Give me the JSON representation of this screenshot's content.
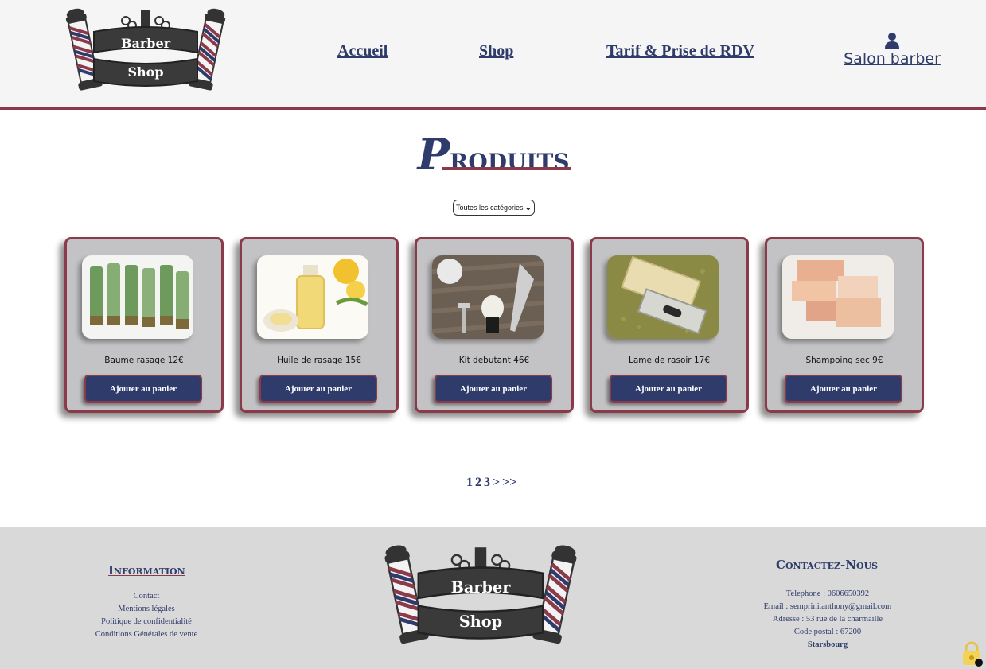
{
  "header": {
    "logo_text_top": "Barber",
    "logo_text_bottom": "Shop",
    "nav": [
      {
        "label": "Accueil"
      },
      {
        "label": "Shop"
      },
      {
        "label": "Tarif & Prise de RDV"
      }
    ],
    "account": {
      "label": "Salon barber",
      "icon": "user-icon"
    }
  },
  "main": {
    "title_cap": "P",
    "title_rest": "roduits",
    "category_filter": {
      "selected": "Toutes les catégories"
    },
    "products": [
      {
        "name": "Baume rasage 12€",
        "button": "Ajouter au panier",
        "image": "green-tubes"
      },
      {
        "name": "Huile de rasage 15€",
        "button": "Ajouter au panier",
        "image": "oil-bottle"
      },
      {
        "name": "Kit debutant 46€",
        "button": "Ajouter au panier",
        "image": "shaving-kit"
      },
      {
        "name": "Lame de rasoir 17€",
        "button": "Ajouter au panier",
        "image": "razor-blade"
      },
      {
        "name": "Shampoing sec 9€",
        "button": "Ajouter au panier",
        "image": "soap-bars"
      }
    ],
    "pagination": {
      "pages": [
        "1",
        "2",
        "3"
      ],
      "next": ">",
      "last": ">>"
    }
  },
  "footer": {
    "info_title": "Information",
    "info_links": [
      "Contact",
      "Mentions légales",
      "Politique de confidentialité",
      "Conditions Générales de vente"
    ],
    "contact_title": "Contactez-Nous",
    "contact_lines": [
      "Telephone : 0606650392",
      "Email : semprini.anthony@gmail.com",
      "Adresse : 53 rue de la charmaille",
      "Code postal : 67200"
    ],
    "city": "Starsbourg"
  },
  "colors": {
    "navy": "#2f3c6b",
    "burgundy": "#8b3a4a",
    "card_bg": "#c3c3c5",
    "footer_bg": "#d9d9da"
  }
}
